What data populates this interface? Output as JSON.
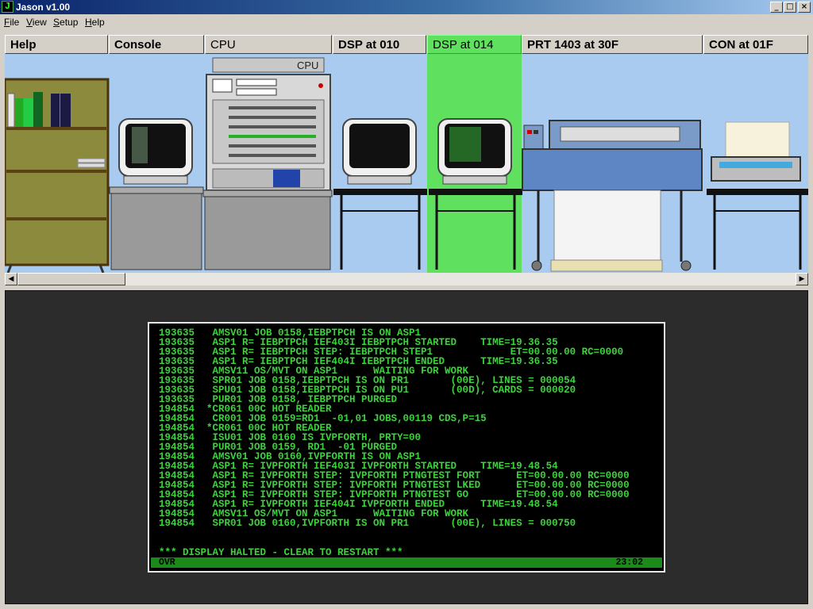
{
  "app": {
    "title": "Jason v1.00",
    "icon_letter": "J"
  },
  "window_controls": {
    "minimize": "_",
    "maximize": "□",
    "close": "×"
  },
  "menu": [
    "File",
    "View",
    "Setup",
    "Help"
  ],
  "tabs": [
    "Help",
    "Console",
    "CPU",
    "DSP at 010",
    "DSP at 014",
    "PRT 1403 at 30F",
    "CON at 01F"
  ],
  "active_tab": "DSP at 014",
  "scene": {
    "cpu_label": "CPU"
  },
  "scrollbar": {
    "left_arrow": "◀",
    "right_arrow": "▶"
  },
  "terminal": {
    "lines": [
      "193635   AMSV01 JOB 0158,IEBPTPCH IS ON ASP1",
      "193635   ASP1 R= IEBPTPCH IEF403I IEBPTPCH STARTED    TIME=19.36.35",
      "193635   ASP1 R= IEBPTPCH STEP: IEBPTPCH STEP1             ET=00.00.00 RC=0000",
      "193635   ASP1 R= IEBPTPCH IEF404I IEBPTPCH ENDED      TIME=19.36.35",
      "193635   AMSV11 OS/MVT ON ASP1      WAITING FOR WORK",
      "193635   SPR01 JOB 0158,IEBPTPCH IS ON PR1       (00E), LINES = 000054",
      "193635   SPU01 JOB 0158,IEBPTPCH IS ON PU1       (00D), CARDS = 000020",
      "193635   PUR01 JOB 0158, IEBPTPCH PURGED",
      "194854  *CR061 00C HOT READER",
      "194854   CR001 JOB 0159=RD1  -01,01 JOBS,00119 CDS,P=15",
      "194854  *CR061 00C HOT READER",
      "194854   ISU01 JOB 0160 IS IVPFORTH, PRTY=00",
      "194854   PUR01 JOB 0159, RD1  -01 PURGED",
      "194854   AMSV01 JOB 0160,IVPFORTH IS ON ASP1",
      "194854   ASP1 R= IVPFORTH IEF403I IVPFORTH STARTED    TIME=19.48.54",
      "194854   ASP1 R= IVPFORTH STEP: IVPFORTH PTNGTEST FORT      ET=00.00.00 RC=0000",
      "194854   ASP1 R= IVPFORTH STEP: IVPFORTH PTNGTEST LKED      ET=00.00.00 RC=0000",
      "194854   ASP1 R= IVPFORTH STEP: IVPFORTH PTNGTEST GO        ET=00.00.00 RC=0000",
      "194854   ASP1 R= IVPFORTH IEF404I IVPFORTH ENDED      TIME=19.48.54",
      "194854   AMSV11 OS/MVT ON ASP1      WAITING FOR WORK",
      "194854   SPR01 JOB 0160,IVPFORTH IS ON PR1       (00E), LINES = 000750"
    ],
    "halt_message": "*** DISPLAY HALTED - CLEAR TO RESTART ***",
    "status_mode": "OVR",
    "status_clock": "23:02"
  },
  "colors": {
    "terminal_text": "#3dd13d",
    "active_tab": "#5fe05f",
    "scene_bg": "#a9cbf0"
  }
}
